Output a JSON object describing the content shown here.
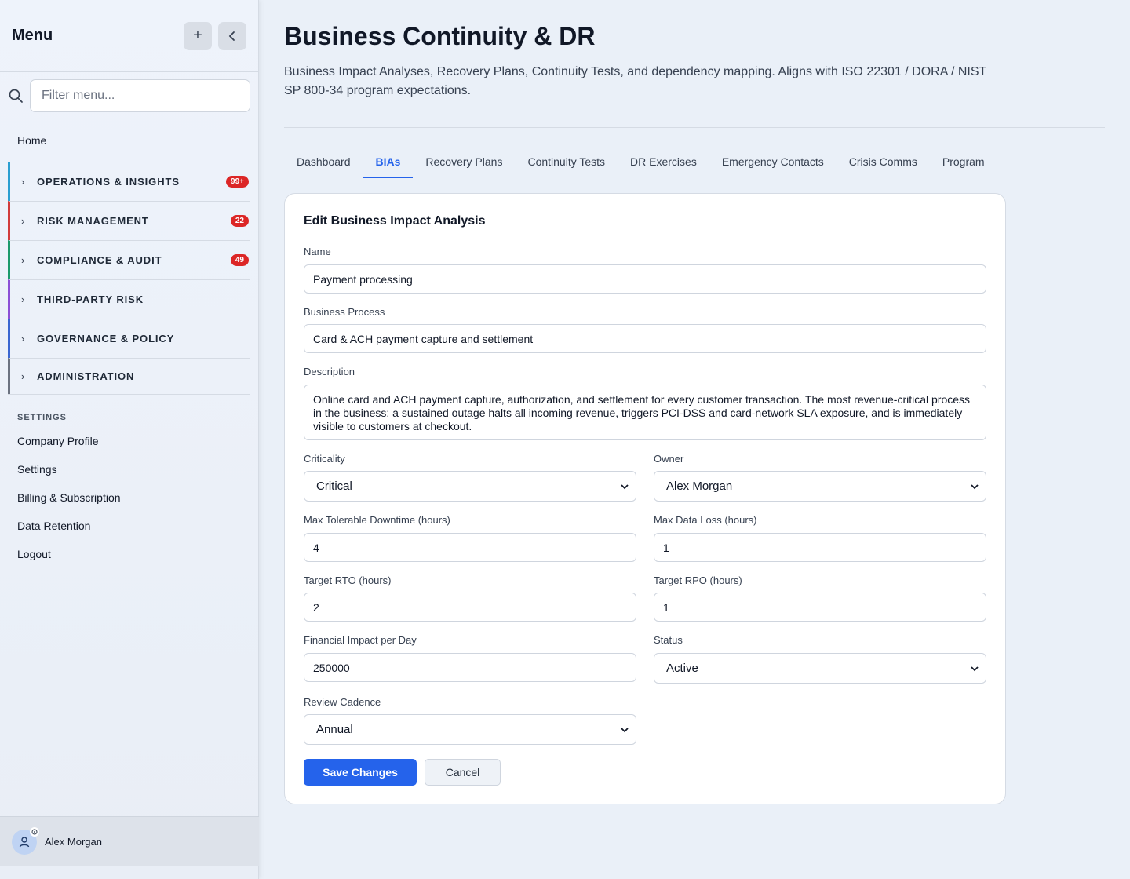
{
  "sidebar": {
    "title": "Menu",
    "filter_placeholder": "Filter menu...",
    "home": "Home",
    "groups": [
      {
        "label": "OPERATIONS & INSIGHTS",
        "badge": "99+",
        "color": "#2b9fd1"
      },
      {
        "label": "RISK MANAGEMENT",
        "badge": "22",
        "color": "#d13b3b"
      },
      {
        "label": "COMPLIANCE & AUDIT",
        "badge": "49",
        "color": "#1b9a6b"
      },
      {
        "label": "THIRD-PARTY RISK",
        "badge": "",
        "color": "#8b4fd6"
      },
      {
        "label": "GOVERNANCE & POLICY",
        "badge": "",
        "color": "#3a66d1"
      },
      {
        "label": "ADMINISTRATION",
        "badge": "",
        "color": "#6b7280"
      }
    ],
    "settings_heading": "SETTINGS",
    "settings_links": [
      "Company Profile",
      "Settings",
      "Billing & Subscription",
      "Data Retention",
      "Logout"
    ],
    "user_name": "Alex Morgan"
  },
  "page": {
    "title": "Business Continuity & DR",
    "description": "Business Impact Analyses, Recovery Plans, Continuity Tests, and dependency mapping. Aligns with ISO 22301 / DORA / NIST SP 800-34 program expectations."
  },
  "tabs": [
    "Dashboard",
    "BIAs",
    "Recovery Plans",
    "Continuity Tests",
    "DR Exercises",
    "Emergency Contacts",
    "Crisis Comms",
    "Program"
  ],
  "active_tab": "BIAs",
  "form": {
    "title": "Edit Business Impact Analysis",
    "name_label": "Name",
    "name_value": "Payment processing",
    "process_label": "Business Process",
    "process_value": "Card & ACH payment capture and settlement",
    "description_label": "Description",
    "description_value": "Online card and ACH payment capture, authorization, and settlement for every customer transaction. The most revenue-critical process in the business: a sustained outage halts all incoming revenue, triggers PCI-DSS and card-network SLA exposure, and is immediately visible to customers at checkout.",
    "criticality_label": "Criticality",
    "criticality_value": "Critical",
    "owner_label": "Owner",
    "owner_value": "Alex Morgan",
    "mtd_label": "Max Tolerable Downtime (hours)",
    "mtd_value": "4",
    "mdl_label": "Max Data Loss (hours)",
    "mdl_value": "1",
    "rto_label": "Target RTO (hours)",
    "rto_value": "2",
    "rpo_label": "Target RPO (hours)",
    "rpo_value": "1",
    "impact_label": "Financial Impact per Day",
    "impact_value": "250000",
    "status_label": "Status",
    "status_value": "Active",
    "cadence_label": "Review Cadence",
    "cadence_value": "Annual",
    "save_label": "Save Changes",
    "cancel_label": "Cancel"
  }
}
